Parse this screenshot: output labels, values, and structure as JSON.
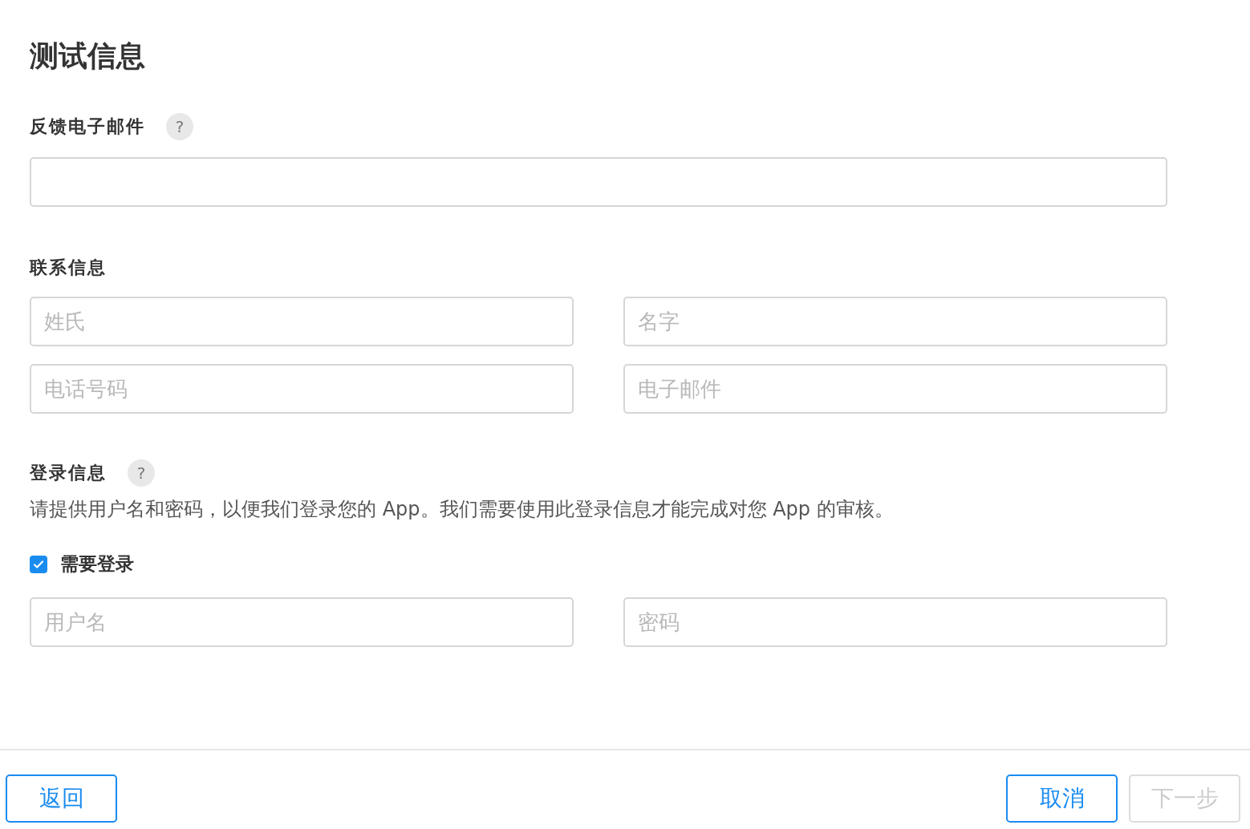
{
  "title": "测试信息",
  "feedback_email": {
    "label": "反馈电子邮件",
    "help": "?"
  },
  "contact": {
    "label": "联系信息",
    "fields": [
      {
        "placeholder": "姓氏"
      },
      {
        "placeholder": "名字"
      },
      {
        "placeholder": "电话号码"
      },
      {
        "placeholder": "电子邮件"
      }
    ]
  },
  "login": {
    "label": "登录信息",
    "help": "?",
    "description": "请提供用户名和密码，以便我们登录您的 App。我们需要使用此登录信息才能完成对您 App 的审核。",
    "checkbox": {
      "label": "需要登录",
      "checked": true
    },
    "fields": [
      {
        "placeholder": "用户名"
      },
      {
        "placeholder": "密码"
      }
    ]
  },
  "footer": {
    "left_buttons": [
      {
        "label": "返回",
        "disabled": false
      }
    ],
    "right_buttons": [
      {
        "label": "取消",
        "disabled": false
      },
      {
        "label": "下一步",
        "disabled": true
      }
    ]
  }
}
